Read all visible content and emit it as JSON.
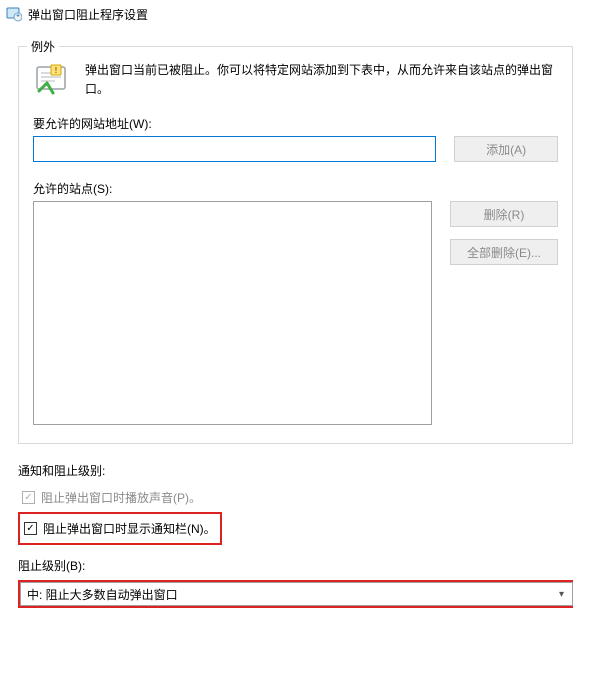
{
  "window": {
    "title": "弹出窗口阻止程序设置"
  },
  "exceptions": {
    "legend": "例外",
    "info": "弹出窗口当前已被阻止。你可以将特定网站添加到下表中，从而允许来自该站点的弹出窗口。",
    "allow_label": "要允许的网站地址(W):",
    "address_value": "",
    "add_btn": "添加(A)",
    "sites_label": "允许的站点(S):",
    "remove_btn": "删除(R)",
    "remove_all_btn": "全部删除(E)..."
  },
  "notify": {
    "title": "通知和阻止级别:",
    "play_sound": "阻止弹出窗口时播放声音(P)。",
    "show_bar": "阻止弹出窗口时显示通知栏(N)。",
    "level_label": "阻止级别(B):",
    "level_selected": "中: 阻止大多数自动弹出窗口"
  }
}
